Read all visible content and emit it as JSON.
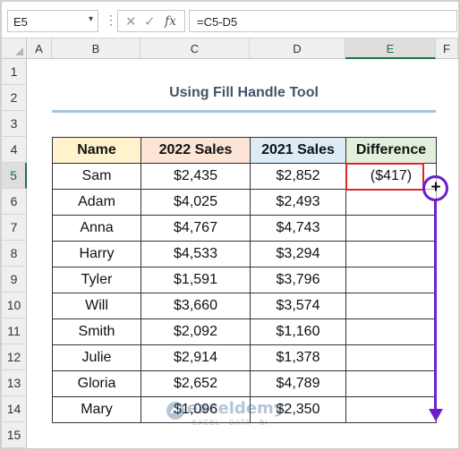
{
  "formula_bar": {
    "name_box": "E5",
    "name_box_arrow": "▾",
    "dots": "⋮",
    "cancel_icon": "✕",
    "enter_icon": "✓",
    "fx_label": "fx",
    "formula": "=C5-D5"
  },
  "columns": [
    "A",
    "B",
    "C",
    "D",
    "E",
    "F"
  ],
  "selected_column": "E",
  "rows": [
    "1",
    "2",
    "3",
    "4",
    "5",
    "6",
    "7",
    "8",
    "9",
    "10",
    "11",
    "12",
    "13",
    "14",
    "15"
  ],
  "selected_row": "5",
  "sheet": {
    "title": "Using Fill Handle Tool",
    "headers": [
      "Name",
      "2022 Sales",
      "2021 Sales",
      "Difference"
    ],
    "header_colors": {
      "name": "#fff2cc",
      "sales_2022": "#fce4d6",
      "sales_2021": "#ddebf7",
      "difference": "#e2efda"
    },
    "records": [
      {
        "name": "Sam",
        "s2022": "$2,435",
        "s2021": "$2,852",
        "diff": "($417)"
      },
      {
        "name": "Adam",
        "s2022": "$4,025",
        "s2021": "$2,493",
        "diff": ""
      },
      {
        "name": "Anna",
        "s2022": "$4,767",
        "s2021": "$4,743",
        "diff": ""
      },
      {
        "name": "Harry",
        "s2022": "$4,533",
        "s2021": "$3,294",
        "diff": ""
      },
      {
        "name": "Tyler",
        "s2022": "$1,591",
        "s2021": "$3,796",
        "diff": ""
      },
      {
        "name": "Will",
        "s2022": "$3,660",
        "s2021": "$3,574",
        "diff": ""
      },
      {
        "name": "Smith",
        "s2022": "$2,092",
        "s2021": "$1,160",
        "diff": ""
      },
      {
        "name": "Julie",
        "s2022": "$2,914",
        "s2021": "$1,378",
        "diff": ""
      },
      {
        "name": "Gloria",
        "s2022": "$2,652",
        "s2021": "$4,789",
        "diff": ""
      },
      {
        "name": "Mary",
        "s2022": "$1,096",
        "s2021": "$2,350",
        "diff": ""
      }
    ]
  },
  "annotation": {
    "fill_handle_icon": "+",
    "accent_color": "#6a1fc9",
    "selection_color": "#e0262a"
  },
  "watermark": {
    "name": "exceldemy",
    "tagline": "EXCEL · DATA · BI"
  }
}
